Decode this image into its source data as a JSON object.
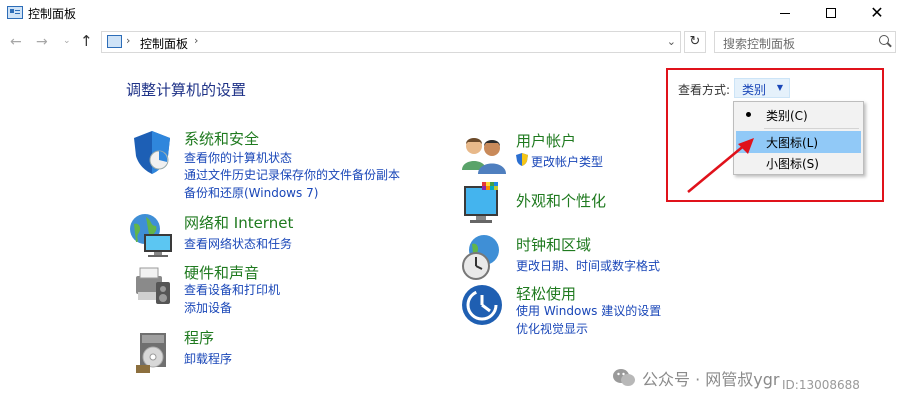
{
  "window": {
    "title": "控制面板",
    "close_glyph": "✕"
  },
  "nav": {
    "back_glyph": "←",
    "forward_glyph": "→",
    "dropdown_glyph": "⌄",
    "up_glyph": "↑",
    "refresh_glyph": "↻",
    "address_chevron": "›",
    "address_dropdown": "⌄",
    "breadcrumb": "控制面板"
  },
  "search": {
    "placeholder": "搜索控制面板"
  },
  "main": {
    "heading": "调整计算机的设置"
  },
  "view": {
    "label": "查看方式:",
    "selected": "类别",
    "arrow": "▼",
    "options": [
      "类别(C)",
      "大图标(L)",
      "小图标(S)"
    ],
    "highlighted_index": 1
  },
  "categories_left": [
    {
      "title": "系统和安全",
      "links": [
        "查看你的计算机状态",
        "通过文件历史记录保存你的文件备份副本",
        "备份和还原(Windows 7)"
      ],
      "icon": "shield-icon"
    },
    {
      "title": "网络和 Internet",
      "links": [
        "查看网络状态和任务"
      ],
      "icon": "network-icon"
    },
    {
      "title": "硬件和声音",
      "links": [
        "查看设备和打印机",
        "添加设备"
      ],
      "icon": "printer-icon"
    },
    {
      "title": "程序",
      "links": [
        "卸载程序"
      ],
      "icon": "programs-icon"
    }
  ],
  "categories_right": [
    {
      "title": "用户帐户",
      "links": [
        "更改帐户类型"
      ],
      "icon": "users-icon"
    },
    {
      "title": "外观和个性化",
      "links": [],
      "icon": "monitor-icon"
    },
    {
      "title": "时钟和区域",
      "links": [
        "更改日期、时间或数字格式"
      ],
      "icon": "clock-icon"
    },
    {
      "title": "轻松使用",
      "links": [
        "使用 Windows 建议的设置",
        "优化视觉显示"
      ],
      "icon": "accessibility-icon"
    }
  ],
  "watermark": {
    "text": "公众号 · 网管叔ygr",
    "id": "ID:13008688"
  },
  "colors": {
    "category_title": "#1f7a1f",
    "link": "#1a47b8",
    "heading": "#1e3287",
    "highlight": "#91c9f7",
    "annotation": "#e0121b"
  }
}
